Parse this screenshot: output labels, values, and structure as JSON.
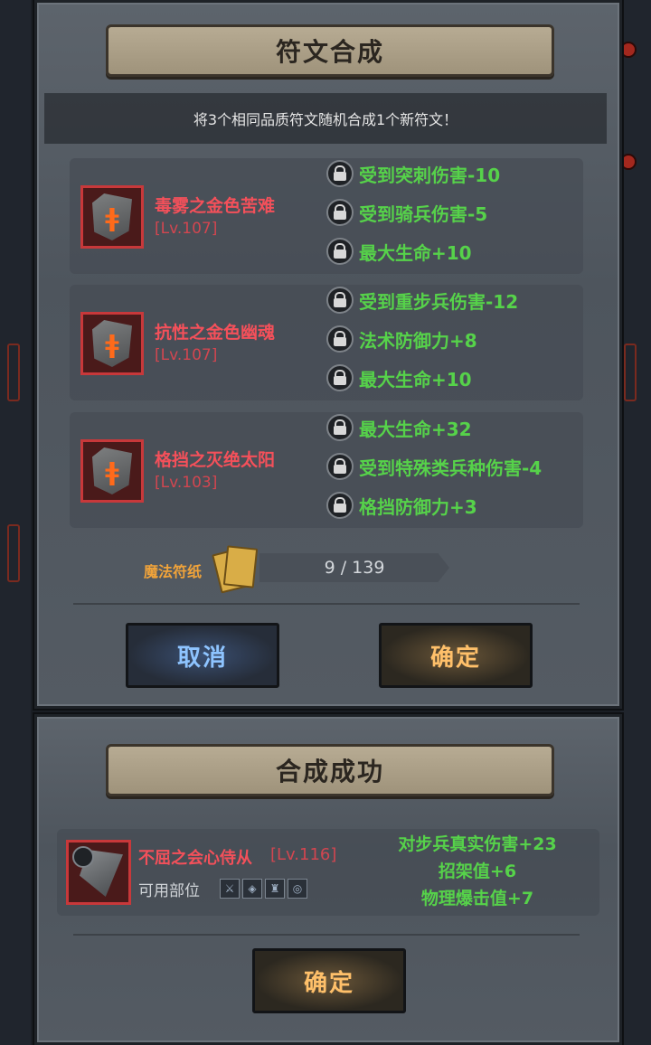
{
  "synth_panel": {
    "title": "符文合成",
    "instruction": "将3个相同品质符文随机合成1个新符文！",
    "runes": [
      {
        "name": "毒雾之金色苦难",
        "level": "[Lv.107]",
        "attributes": [
          "受到突刺伤害-10",
          "受到骑兵伤害-5",
          "最大生命+10"
        ]
      },
      {
        "name": "抗性之金色幽魂",
        "level": "[Lv.107]",
        "attributes": [
          "受到重步兵伤害-12",
          "法术防御力+8",
          "最大生命+10"
        ]
      },
      {
        "name": "格挡之灭绝太阳",
        "level": "[Lv.103]",
        "attributes": [
          "最大生命+32",
          "受到特殊类兵种伤害-4",
          "格挡防御力+3"
        ]
      }
    ],
    "magic_paper": {
      "label": "魔法符纸",
      "count": "9 / 139"
    },
    "cancel_label": "取消",
    "confirm_label": "确定"
  },
  "success_panel": {
    "title": "合成成功",
    "result": {
      "name": "不屈之会心侍从",
      "level": "[Lv.116]",
      "slots_label": "可用部位",
      "slot_icons": [
        "sword-slot-icon",
        "shield-slot-icon",
        "armor-slot-icon",
        "ring-slot-icon"
      ],
      "attributes": [
        "对步兵真实伤害+23",
        "招架值+6",
        "物理爆击值+7"
      ]
    },
    "confirm_label": "确定"
  },
  "colors": {
    "rune_name": "#f4505a",
    "attribute": "#56d24a",
    "cancel_text": "#8ec4ff",
    "confirm_text": "#ffc06a",
    "paper_label": "#f0a33a"
  }
}
